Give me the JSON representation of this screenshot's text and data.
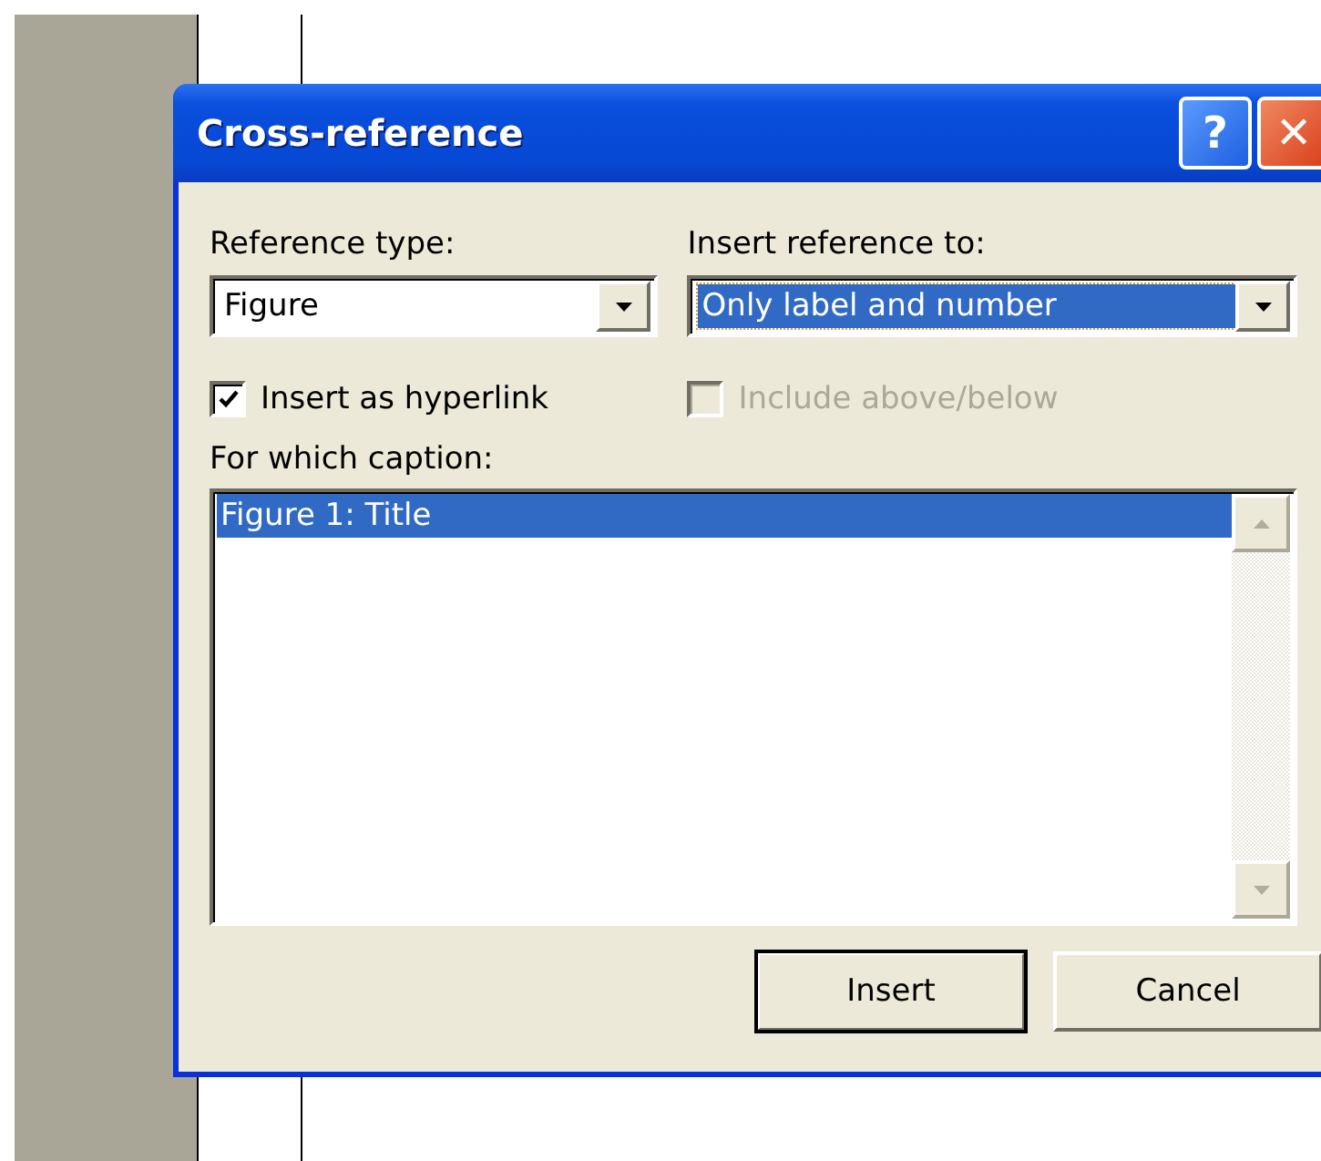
{
  "window": {
    "title": "Cross-reference",
    "buttons": [
      {
        "kind": "help",
        "label": "?"
      },
      {
        "kind": "close",
        "label": "✕"
      }
    ]
  },
  "reference_type": {
    "label": "Reference type:",
    "value": "Figure"
  },
  "insert_reference_to": {
    "label": "Insert reference to:",
    "value": "Only label and number",
    "selected": true
  },
  "options": [
    {
      "label": "Insert as hyperlink",
      "checked": true,
      "disabled": false
    },
    {
      "label": "Include above/below",
      "checked": false,
      "disabled": true
    }
  ],
  "caption_list": {
    "label": "For which caption:",
    "items": [
      {
        "text": "Figure 1: Title",
        "selected": true
      }
    ]
  },
  "buttons": [
    {
      "label": "Insert",
      "default": true
    },
    {
      "label": "Cancel",
      "default": false
    }
  ]
}
